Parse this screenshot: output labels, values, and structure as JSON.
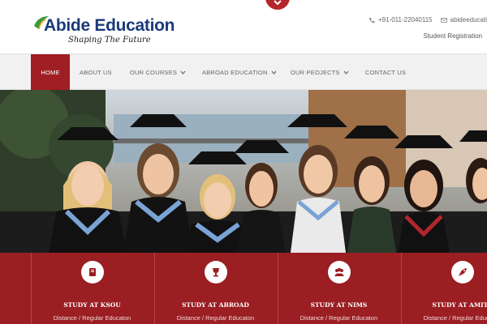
{
  "header": {
    "brand": "Abide Education",
    "tagline": "Shaping The Future",
    "phone": "+91-011-22040115",
    "email": "abideeducati",
    "student_link": "Student Registration"
  },
  "nav": {
    "items": [
      {
        "label": "HOME",
        "active": true,
        "dropdown": false
      },
      {
        "label": "ABOUT US",
        "active": false,
        "dropdown": false
      },
      {
        "label": "OUR COURSES",
        "active": false,
        "dropdown": true
      },
      {
        "label": "ABROAD EDUCATION",
        "active": false,
        "dropdown": true
      },
      {
        "label": "OUR PEOJECTS",
        "active": false,
        "dropdown": true
      },
      {
        "label": "CONTACT US",
        "active": false,
        "dropdown": false
      }
    ]
  },
  "features": [
    {
      "title": "STUDY AT KSOU",
      "subtitle": "Distance / Regular Educaton",
      "icon": "book-icon"
    },
    {
      "title": "STUDY AT ABROAD",
      "subtitle": "Distance / Regular Educaton",
      "icon": "trophy-icon"
    },
    {
      "title": "STUDY AT NIMS",
      "subtitle": "Distance / Regular Educaton",
      "icon": "group-icon"
    },
    {
      "title": "STUDY AT AMITY",
      "subtitle": "Distance / Regular Educaton",
      "icon": "rocket-icon"
    }
  ],
  "colors": {
    "brand_blue": "#1b3a7a",
    "accent_red": "#9f1e24",
    "feature_bg": "#9a1e22"
  }
}
